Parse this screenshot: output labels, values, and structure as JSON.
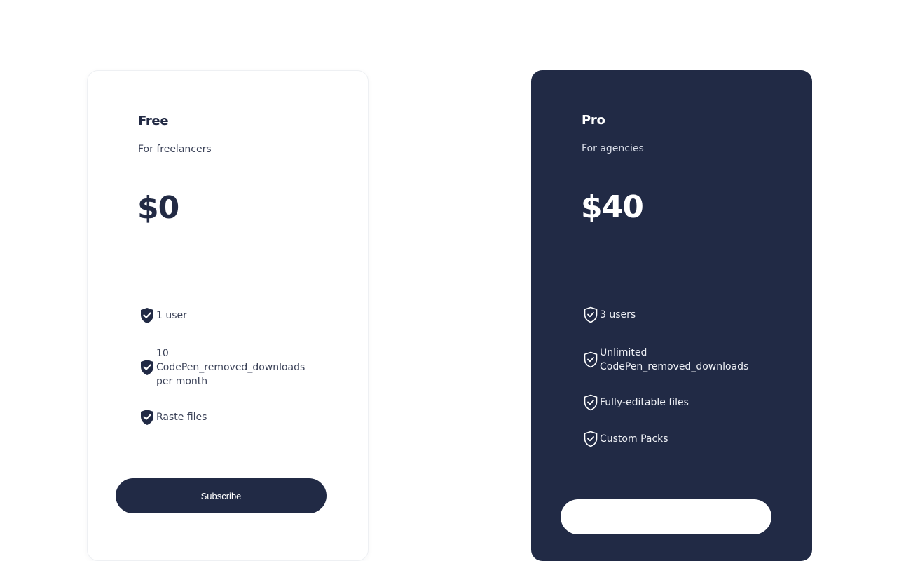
{
  "plans": [
    {
      "name": "Free",
      "subtitle": "For freelancers",
      "price": "$0",
      "features": [
        {
          "label": "1 user",
          "icon": "shield-check-icon"
        },
        {
          "label": "10 CodePen_removed_downloads per month",
          "icon": "shield-check-icon"
        },
        {
          "label": "Raste files",
          "icon": "shield-check-icon"
        }
      ],
      "button_label": "Subscribe"
    },
    {
      "name": "Pro",
      "subtitle": "For agencies",
      "price": "$40",
      "features": [
        {
          "label": "3 users",
          "icon": "shield-check-outline-icon"
        },
        {
          "label": "Unlimited CodePen_removed_downloads",
          "icon": "shield-check-outline-icon"
        },
        {
          "label": "Fully-editable files",
          "icon": "shield-check-outline-icon"
        },
        {
          "label": "Custom Packs",
          "icon": "shield-check-outline-icon"
        }
      ],
      "button_label": ""
    }
  ],
  "colors": {
    "navy": "#212a45",
    "white": "#ffffff",
    "text_muted": "#3b4258"
  }
}
